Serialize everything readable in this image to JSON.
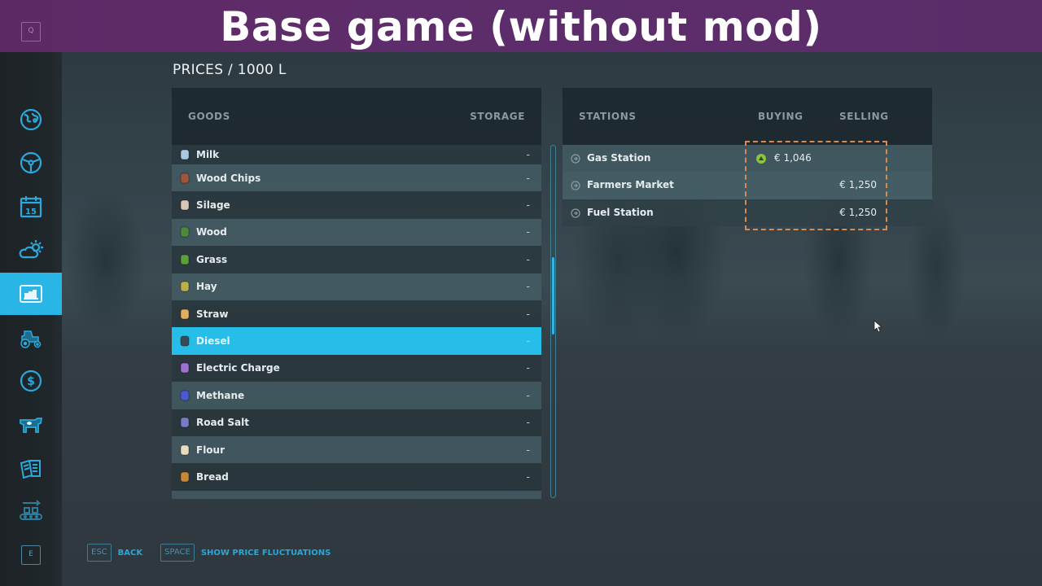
{
  "banner": {
    "title": "Base game (without mod)",
    "left_key": "Q"
  },
  "sidebar": {
    "items": [
      {
        "name": "map",
        "icon": "globe-map-icon",
        "active": false
      },
      {
        "name": "vehicles-overview",
        "icon": "steering-wheel-icon",
        "active": false
      },
      {
        "name": "calendar",
        "icon": "calendar-icon",
        "label": "15",
        "active": false
      },
      {
        "name": "weather",
        "icon": "weather-icon",
        "active": false
      },
      {
        "name": "prices",
        "icon": "prices-chart-icon",
        "active": true
      },
      {
        "name": "vehicles",
        "icon": "tractor-icon",
        "active": false
      },
      {
        "name": "finances",
        "icon": "dollar-icon",
        "active": false
      },
      {
        "name": "animals",
        "icon": "cow-icon",
        "active": false
      },
      {
        "name": "contracts",
        "icon": "contracts-icon",
        "active": false
      },
      {
        "name": "production",
        "icon": "production-conveyor-icon",
        "active": false
      }
    ],
    "bottom_key": "E"
  },
  "page": {
    "title": "PRICES / 1000 L"
  },
  "goods": {
    "headers": {
      "goods": "GOODS",
      "storage": "STORAGE"
    },
    "rows": [
      {
        "name": "Milk",
        "storage": "-",
        "icon": "milk-icon",
        "color": "#a9c9e0"
      },
      {
        "name": "Wood Chips",
        "storage": "-",
        "icon": "wood-chips-icon",
        "color": "#a0563a"
      },
      {
        "name": "Silage",
        "storage": "-",
        "icon": "silage-icon",
        "color": "#d8c8b8"
      },
      {
        "name": "Wood",
        "storage": "-",
        "icon": "tree-icon",
        "color": "#4e8a3a"
      },
      {
        "name": "Grass",
        "storage": "-",
        "icon": "grass-icon",
        "color": "#5aa03a"
      },
      {
        "name": "Hay",
        "storage": "-",
        "icon": "hay-icon",
        "color": "#b9b04a"
      },
      {
        "name": "Straw",
        "storage": "-",
        "icon": "straw-icon",
        "color": "#e0b060"
      },
      {
        "name": "Diesel",
        "storage": "-",
        "icon": "fuel-pump-icon",
        "color": "#3a4a52",
        "selected": true
      },
      {
        "name": "Electric Charge",
        "storage": "-",
        "icon": "battery-icon",
        "color": "#a070d0"
      },
      {
        "name": "Methane",
        "storage": "-",
        "icon": "gas-bottle-icon",
        "color": "#4a5ad0"
      },
      {
        "name": "Road Salt",
        "storage": "-",
        "icon": "road-salt-icon",
        "color": "#7a7ac8"
      },
      {
        "name": "Flour",
        "storage": "-",
        "icon": "flour-icon",
        "color": "#e8dcc0"
      },
      {
        "name": "Bread",
        "storage": "-",
        "icon": "bread-icon",
        "color": "#c8883a"
      }
    ]
  },
  "stations": {
    "headers": {
      "stations": "STATIONS",
      "buying": "BUYING",
      "selling": "SELLING"
    },
    "rows": [
      {
        "name": "Gas Station",
        "buying": "€ 1,046",
        "selling": "",
        "trend": "up"
      },
      {
        "name": "Farmers Market",
        "buying": "",
        "selling": "€ 1,250"
      },
      {
        "name": "Fuel Station",
        "buying": "",
        "selling": "€ 1,250"
      }
    ]
  },
  "colors": {
    "accent": "#27bde9",
    "banner": "#5d2d6b",
    "highlight": "#d98a4f",
    "trend_up": "#8cc43c"
  },
  "footer": {
    "actions": [
      {
        "key": "ESC",
        "label": "BACK"
      },
      {
        "key": "SPACE",
        "label": "SHOW PRICE FLUCTUATIONS"
      }
    ]
  }
}
